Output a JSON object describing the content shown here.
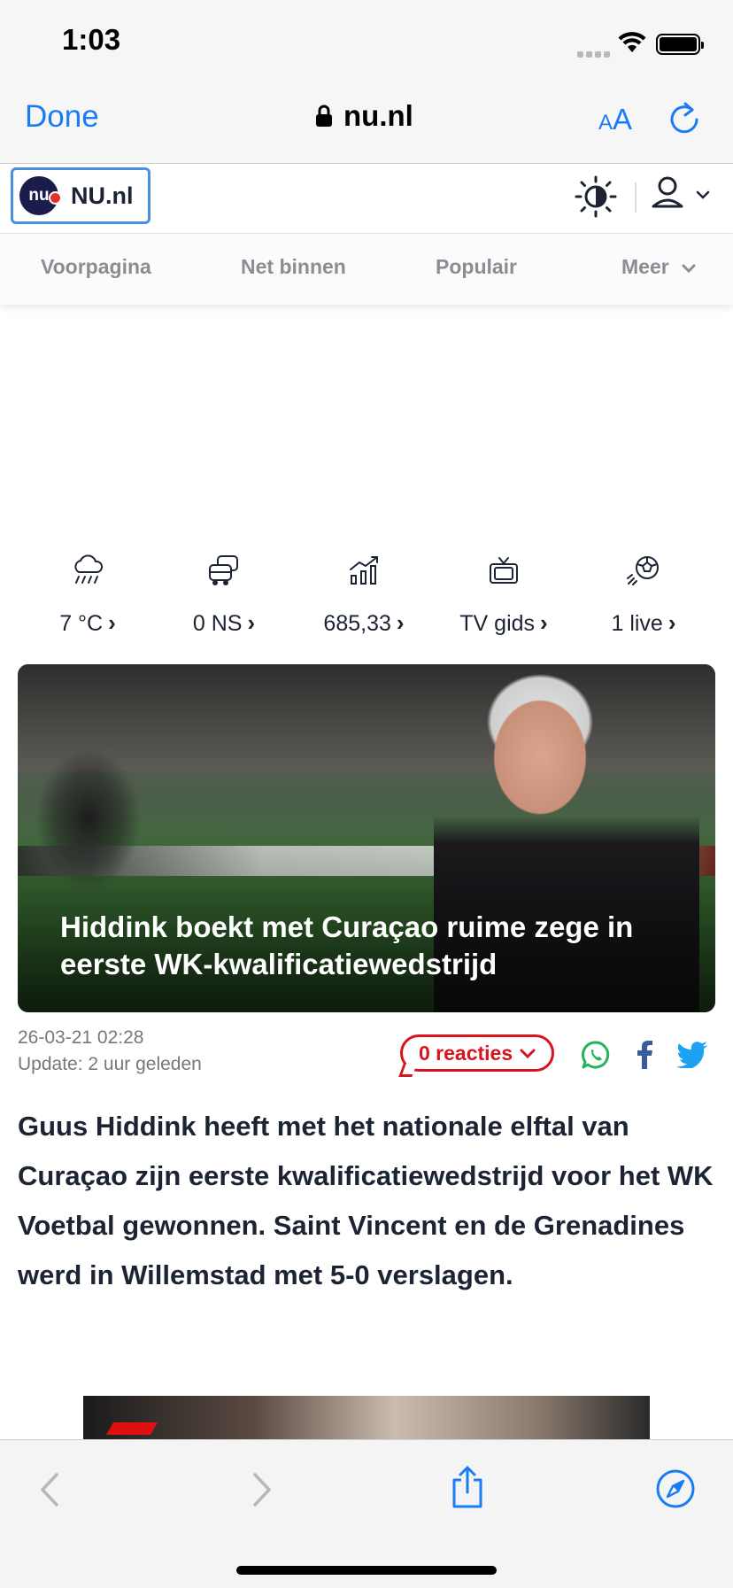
{
  "status_bar": {
    "time": "1:03"
  },
  "browser": {
    "done_label": "Done",
    "url": "nu.nl",
    "text_size_small": "A",
    "text_size_large": "A"
  },
  "site": {
    "logo_mark": "nu",
    "logo_text": "NU.nl",
    "nav": [
      "Voorpagina",
      "Net binnen",
      "Populair",
      "Meer"
    ]
  },
  "widgets": [
    {
      "icon": "rain-cloud-icon",
      "label": "7 °C"
    },
    {
      "icon": "traffic-icon",
      "label": "0 NS"
    },
    {
      "icon": "stock-chart-icon",
      "label": "685,33"
    },
    {
      "icon": "tv-icon",
      "label": "TV gids"
    },
    {
      "icon": "football-icon",
      "label": "1 live"
    }
  ],
  "article": {
    "headline": "Hiddink boekt met Curaçao ruime zege in eerste WK-kwalificatiewedstrijd",
    "date": "26-03-21 02:28",
    "updated": "Update: 2 uur geleden",
    "comments_label": "0 reacties",
    "lead": "Guus Hiddink heeft met het nationale elftal van Curaçao zijn eerste kwalificatiewedstrijd voor het WK Voetbal gewonnen. Saint Vincent en de Grenadines werd in Willemstad met 5-0 verslagen."
  },
  "colors": {
    "safari_blue": "#1a7cf5",
    "brand_navy": "#1b1c4b",
    "comment_red": "#d8141d",
    "whatsapp_green": "#25b35a",
    "facebook_blue": "#3b5b9b",
    "twitter_blue": "#1da1f2"
  }
}
